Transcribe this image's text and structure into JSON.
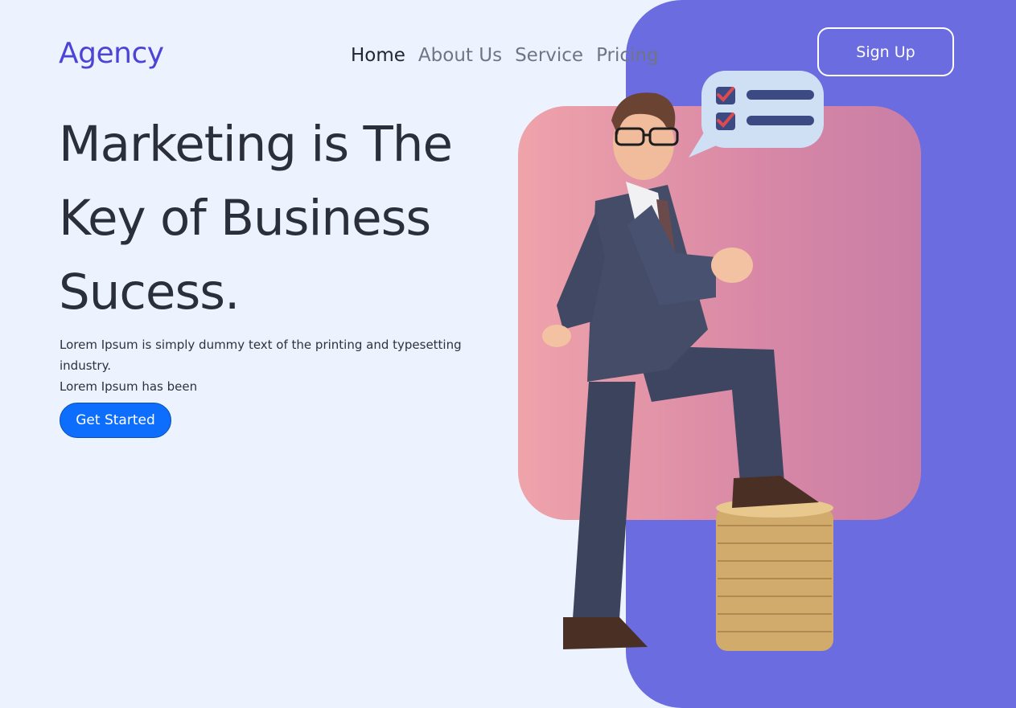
{
  "brand": {
    "logo_text": "Agency"
  },
  "nav": {
    "items": [
      "Home",
      "About Us",
      "Service",
      "Pricing"
    ],
    "active": "Home"
  },
  "header": {
    "signup_label": "Sign Up"
  },
  "hero": {
    "title_lines": [
      "Marketing is The",
      "Key of Business",
      "Sucess."
    ],
    "description_lines": [
      "Lorem Ipsum is simply dummy text of the printing and typesetting industry.",
      "Lorem Ipsum has been"
    ],
    "cta_label": "Get Started"
  },
  "colors": {
    "background": "#ecf3ff",
    "brand": "#4b44d6",
    "purple_panel": "#6a6ce0",
    "pink_panel": "#e29aa8",
    "cta": "#0d6efd",
    "heading": "#2b2f3a"
  },
  "illustration": {
    "icons": [
      "businessman-illustration",
      "checklist-speech-bubble-icon",
      "coin-stack-icon"
    ]
  }
}
